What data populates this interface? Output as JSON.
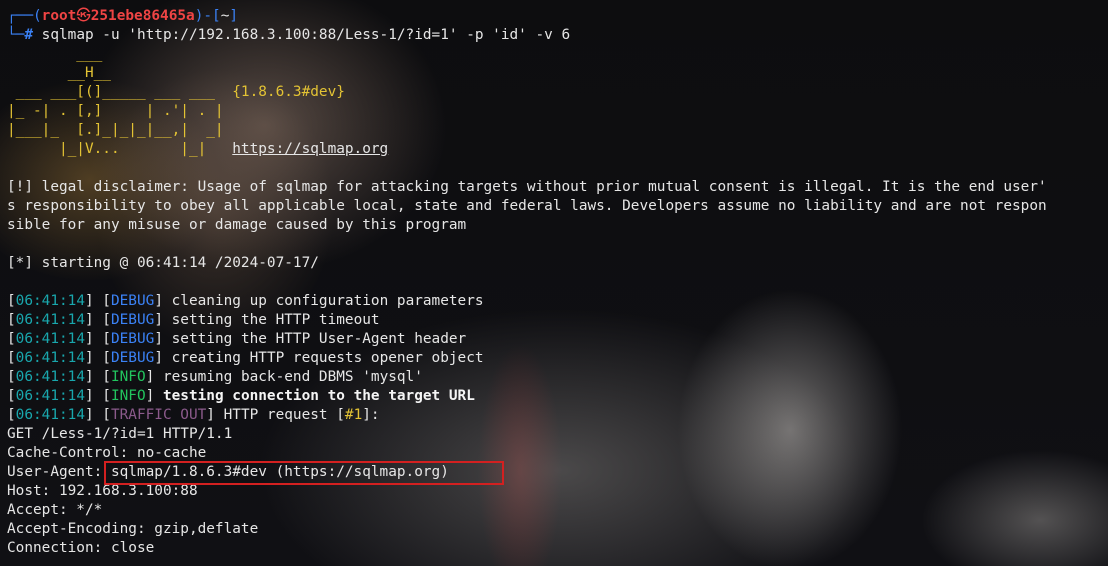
{
  "prompt": {
    "corner_top": "┌──",
    "open_paren": "(",
    "user": "root",
    "skull": "㉿",
    "host": "251ebe86465a",
    "close_paren": ")-[",
    "dir": "~",
    "close_bracket": "]",
    "corner_bottom": "└─",
    "hash": "#",
    "command": " sqlmap -u 'http://192.168.3.100:88/Less-1/?id=1' -p 'id' -v 6"
  },
  "logo": {
    "rows": [
      "        ___",
      "       __H__",
      " ___ ___[(]_____ ___ ___  ",
      "|_ -| . [,]     | .'| . |",
      "|___|_  [.]_|_|_|__,|  _|",
      "      |_|V...       |_|   "
    ],
    "version": "{1.8.6.3#dev}",
    "url": "https://sqlmap.org"
  },
  "disclaimer": [
    "[!] legal disclaimer: Usage of sqlmap for attacking targets without prior mutual consent is illegal. It is the end user'",
    "s responsibility to obey all applicable local, state and federal laws. Developers assume no liability and are not respon",
    "sible for any misuse or damage caused by this program"
  ],
  "starting": "[*] starting @ 06:41:14 /2024-07-17/",
  "log": [
    {
      "time": "06:41:14",
      "level": "DEBUG",
      "msg": "cleaning up configuration parameters"
    },
    {
      "time": "06:41:14",
      "level": "DEBUG",
      "msg": "setting the HTTP timeout"
    },
    {
      "time": "06:41:14",
      "level": "DEBUG",
      "msg": "setting the HTTP User-Agent header"
    },
    {
      "time": "06:41:14",
      "level": "DEBUG",
      "msg": "creating HTTP requests opener object"
    },
    {
      "time": "06:41:14",
      "level": "INFO",
      "msg": "resuming back-end DBMS 'mysql'"
    },
    {
      "time": "06:41:14",
      "level": "INFO",
      "msg": "testing connection to the target URL"
    },
    {
      "time": "06:41:14",
      "level": "TRAFFIC OUT",
      "msg": "HTTP request [",
      "num": "#1",
      "msg_end": "]:"
    }
  ],
  "request": {
    "request_line": "GET /Less-1/?id=1 HTTP/1.1",
    "cache_control": "Cache-Control: no-cache",
    "ua_key": "User-Agent: ",
    "ua_value": "sqlmap/1.8.6.3#dev (https://sqlmap.org)",
    "host": "Host: 192.168.3.100:88",
    "accept": "Accept: */*",
    "accept_encoding": "Accept-Encoding: gzip,deflate",
    "connection": "Connection: close"
  },
  "colors": {
    "timestamp": "#19a7ad",
    "debug": "#3b82f6",
    "info": "#22c55e",
    "traffic": "#8b5a8b",
    "logo": "#e3c334",
    "highlight_box": "#d32020"
  }
}
